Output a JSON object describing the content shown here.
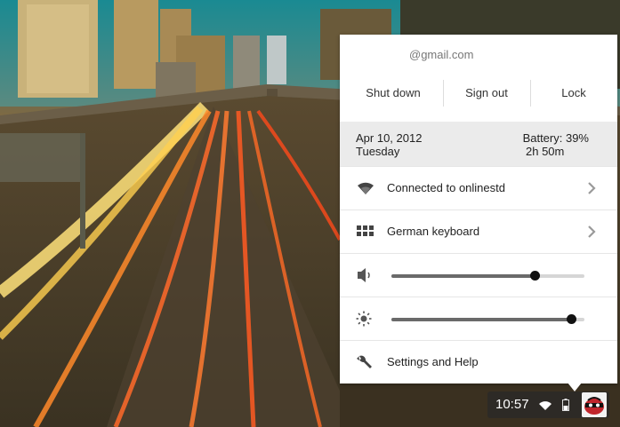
{
  "account": {
    "email": "@gmail.com"
  },
  "actions": {
    "shutdown": "Shut down",
    "signout": "Sign out",
    "lock": "Lock"
  },
  "status": {
    "date": "Apr 10, 2012",
    "weekday": "Tuesday",
    "battery": "Battery: 39%",
    "battery_time": "2h 50m"
  },
  "network": {
    "label": "Connected to onlinestd",
    "icon": "wifi-icon"
  },
  "keyboard": {
    "label": "German keyboard",
    "icon": "keyboard-icon"
  },
  "volume": {
    "level": 0.74,
    "icon": "speaker-icon"
  },
  "brightness": {
    "level": 0.93,
    "icon": "brightness-icon"
  },
  "settings": {
    "label": "Settings and Help",
    "icon": "wrench-icon"
  },
  "tray": {
    "time": "10:57"
  },
  "colors": {
    "popup_bg": "#ffffff",
    "status_bg": "#ebebeb",
    "slider_fill": "#6a6a6a",
    "slider_track": "#d6d6d6"
  }
}
